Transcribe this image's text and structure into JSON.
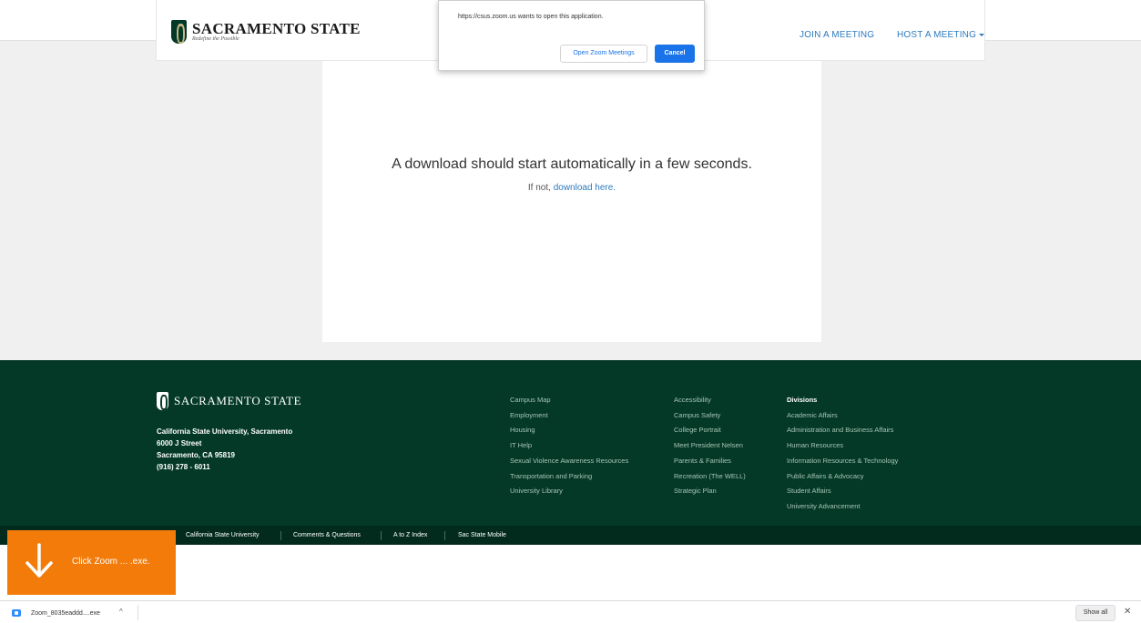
{
  "header": {
    "logo_name": "SACRAMENTO STATE",
    "logo_tagline": "Redefine the Possible",
    "nav": {
      "join": "JOIN A MEETING",
      "host": "HOST A MEETING"
    }
  },
  "dialog": {
    "message": "https://csus.zoom.us wants to open this application.",
    "open_label": "Open Zoom Meetings",
    "cancel_label": "Cancel"
  },
  "main": {
    "message": "A download should start automatically in a few seconds.",
    "sub_prefix": "If not, ",
    "sub_link": "download here."
  },
  "footer": {
    "logo_name": "SACRAMENTO STATE",
    "address": {
      "university": "California State University, Sacramento",
      "street": "6000 J Street",
      "city": "Sacramento, CA 95819",
      "phone": "(916) 278 - 6011"
    },
    "col1": [
      "Campus Map",
      "Employment",
      "Housing",
      "IT Help",
      "Sexual Violence Awareness Resources",
      "Transportation and Parking",
      "University Library"
    ],
    "col2": [
      "Accessibility",
      "Campus Safety",
      "College Portrait",
      "Meet President Nelsen",
      "Parents & Families",
      "Recreation (The WELL)",
      "Strategic Plan"
    ],
    "col3_heading": "Divisions",
    "col3": [
      "Academic Affairs",
      "Administration and Business Affairs",
      "Human Resources",
      "Information Resources & Technology",
      "Public Affairs & Advocacy",
      "Student Affairs",
      "University Advancement"
    ],
    "bar_links": [
      "California State University",
      "Comments & Questions",
      "A to Z Index",
      "Sac State Mobile"
    ]
  },
  "notification": {
    "text": "Click Zoom ... .exe."
  },
  "download_bar": {
    "file_name": "Zoom_8035eaddd....exe",
    "chevron": "^",
    "show_all": "Show all",
    "close": "✕"
  },
  "colors": {
    "sac_green": "#043927",
    "link_blue": "#2d7bbd",
    "chrome_blue": "#1a73e8",
    "notify_orange": "#f27b0a"
  }
}
